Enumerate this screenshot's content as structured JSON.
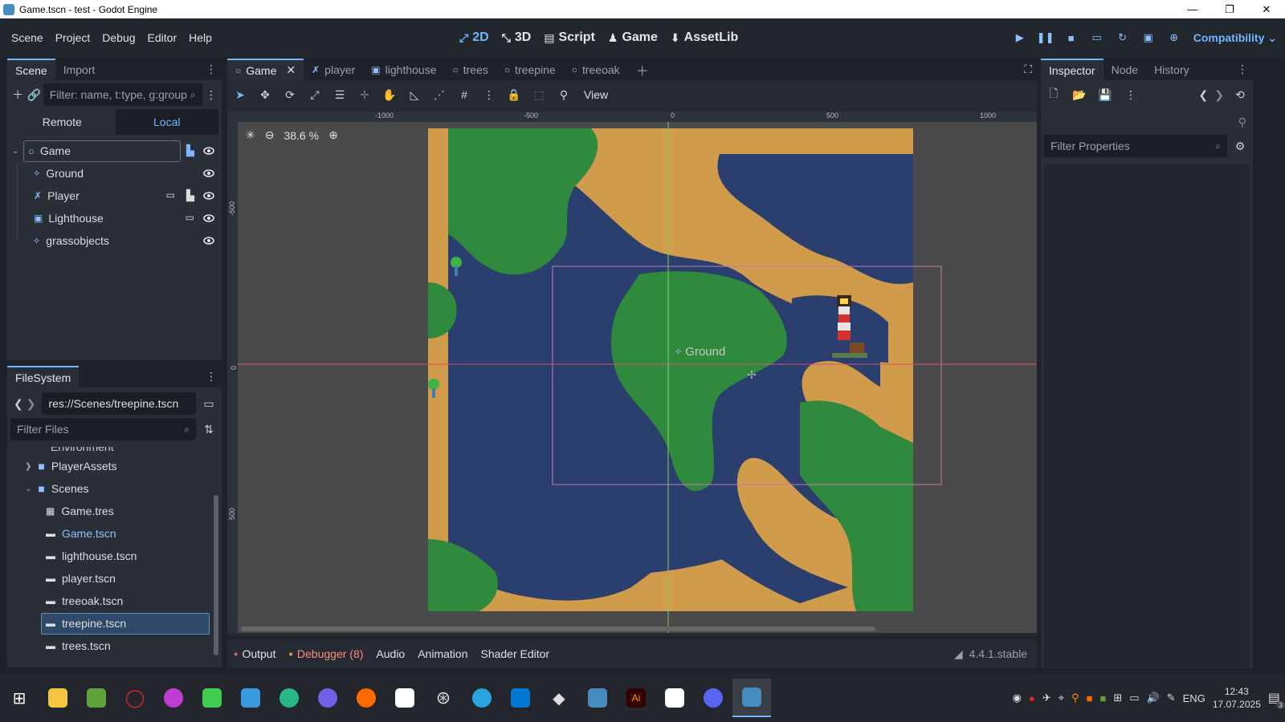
{
  "window": {
    "title": "Game.tscn - test - Godot Engine",
    "minimize": "—",
    "maximize": "❐",
    "close": "✕"
  },
  "menu": [
    "Scene",
    "Project",
    "Debug",
    "Editor",
    "Help"
  ],
  "main_screens": [
    {
      "label": "2D",
      "icon": "2d-icon",
      "active": true
    },
    {
      "label": "3D",
      "icon": "3d-icon",
      "active": false
    },
    {
      "label": "Script",
      "icon": "script-icon",
      "active": false
    },
    {
      "label": "Game",
      "icon": "game-icon",
      "active": false
    },
    {
      "label": "AssetLib",
      "icon": "assetlib-icon",
      "active": false
    }
  ],
  "renderer": "Compatibility",
  "scene_dock": {
    "tabs": [
      "Scene",
      "Import"
    ],
    "filter_placeholder": "Filter: name, t:type, g:group",
    "remote": "Remote",
    "local": "Local",
    "nodes": [
      {
        "name": "Game",
        "depth": 0,
        "icon": "node2d-icon",
        "selected": true
      },
      {
        "name": "Ground",
        "depth": 1,
        "icon": "tilemap-icon"
      },
      {
        "name": "Player",
        "depth": 1,
        "icon": "character-icon"
      },
      {
        "name": "Lighthouse",
        "depth": 1,
        "icon": "static-body-icon"
      },
      {
        "name": "grassobjects",
        "depth": 1,
        "icon": "tilemap-icon"
      }
    ]
  },
  "filesystem": {
    "tab": "FileSystem",
    "path": "res://Scenes/treepine.tscn",
    "filter_placeholder": "Filter Files",
    "items": [
      {
        "name": "PlayerAssets",
        "type": "folder",
        "depth": 0
      },
      {
        "name": "Scenes",
        "type": "folder",
        "depth": 0
      },
      {
        "name": "Game.tres",
        "type": "resource",
        "depth": 1
      },
      {
        "name": "Game.tscn",
        "type": "scene",
        "depth": 1,
        "active": true
      },
      {
        "name": "lighthouse.tscn",
        "type": "scene",
        "depth": 1
      },
      {
        "name": "player.tscn",
        "type": "scene",
        "depth": 1
      },
      {
        "name": "treeoak.tscn",
        "type": "scene",
        "depth": 1
      },
      {
        "name": "treepine.tscn",
        "type": "scene",
        "depth": 1,
        "selected": true
      },
      {
        "name": "trees.tscn",
        "type": "scene",
        "depth": 1
      }
    ]
  },
  "editor_tabs": [
    {
      "label": "Game",
      "active": true,
      "close": "✕"
    },
    {
      "label": "player",
      "active": false
    },
    {
      "label": "lighthouse",
      "active": false
    },
    {
      "label": "trees",
      "active": false
    },
    {
      "label": "treepine",
      "active": false
    },
    {
      "label": "treeoak",
      "active": false
    }
  ],
  "toolbar": {
    "view": "View"
  },
  "viewport": {
    "zoom": "38.6 %",
    "ground_label": "Ground",
    "ruler_x": [
      "-1000",
      "-500",
      "0",
      "500",
      "1000"
    ],
    "ruler_y": [
      "-500",
      "0",
      "500"
    ]
  },
  "inspector": {
    "tabs": [
      "Inspector",
      "Node",
      "History"
    ],
    "filter_placeholder": "Filter Properties"
  },
  "bottom": {
    "tabs": [
      "Output",
      "Debugger (8)",
      "Audio",
      "Animation",
      "Shader Editor"
    ],
    "version": "4.4.1.stable"
  },
  "taskbar": {
    "lang": "ENG",
    "time": "12:43",
    "date": "17.07.2025",
    "notif": "3",
    "colors": {
      "blue": "#0078d4",
      "green": "#5ea33b",
      "red": "#e0242e",
      "purple": "#7160e8",
      "godot": "#478cbf"
    }
  },
  "colors": {
    "accent": "#6fb6ff",
    "water": "#2a3f6e",
    "sand": "#d19b4c",
    "grass": "#2f8a3d"
  }
}
